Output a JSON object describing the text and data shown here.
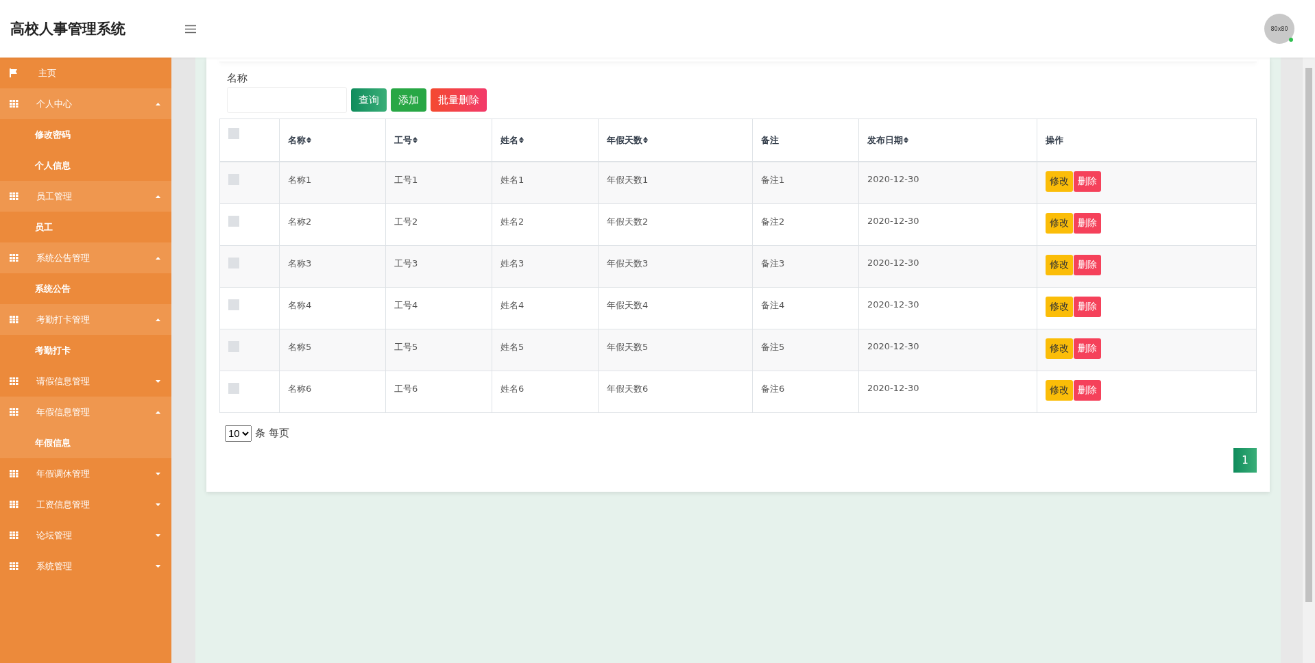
{
  "header": {
    "title": "高校人事管理系统",
    "avatar": {
      "text": "80x80",
      "online": true
    }
  },
  "sidebar": {
    "items": [
      {
        "kind": "home",
        "label": "主页",
        "selected": false
      },
      {
        "kind": "group",
        "label": "个人中心",
        "expanded": true,
        "children": [
          {
            "label": "修改密码",
            "selected": false
          },
          {
            "label": "个人信息",
            "selected": false
          }
        ]
      },
      {
        "kind": "group",
        "label": "员工管理",
        "expanded": true,
        "children": [
          {
            "label": "员工",
            "selected": false
          }
        ]
      },
      {
        "kind": "group",
        "label": "系统公告管理",
        "expanded": true,
        "children": [
          {
            "label": "系统公告",
            "selected": false
          }
        ]
      },
      {
        "kind": "group",
        "label": "考勤打卡管理",
        "expanded": true,
        "children": [
          {
            "label": "考勤打卡",
            "selected": false
          }
        ]
      },
      {
        "kind": "group",
        "label": "请假信息管理",
        "expanded": false
      },
      {
        "kind": "group",
        "label": "年假信息管理",
        "expanded": true,
        "children": [
          {
            "label": "年假信息",
            "selected": true
          }
        ]
      },
      {
        "kind": "group",
        "label": "年假调休管理",
        "expanded": false
      },
      {
        "kind": "group",
        "label": "工资信息管理",
        "expanded": false
      },
      {
        "kind": "group",
        "label": "论坛管理",
        "expanded": false
      },
      {
        "kind": "group",
        "label": "系统管理",
        "expanded": false
      }
    ]
  },
  "search": {
    "label": "名称",
    "buttons": [
      {
        "kind": "search",
        "label": "查询"
      },
      {
        "kind": "add",
        "label": "添加"
      },
      {
        "kind": "delete",
        "label": "批量删除"
      }
    ]
  },
  "table": {
    "select_all": {
      "checked": false
    },
    "columns": [
      {
        "label": "名称",
        "sortable": true
      },
      {
        "label": "工号",
        "sortable": true
      },
      {
        "label": "姓名",
        "sortable": true
      },
      {
        "label": "年假天数",
        "sortable": true
      },
      {
        "label": "备注",
        "sortable": false
      },
      {
        "label": "发布日期",
        "sortable": true
      },
      {
        "label": "操作",
        "sortable": false
      }
    ],
    "rows": [
      {
        "checked": false,
        "cells": [
          "名称1",
          "工号1",
          "姓名1",
          "年假天数1",
          "备注1",
          "2020-12-30"
        ],
        "actions": [
          "修改",
          "删除"
        ]
      },
      {
        "checked": false,
        "cells": [
          "名称2",
          "工号2",
          "姓名2",
          "年假天数2",
          "备注2",
          "2020-12-30"
        ],
        "actions": [
          "修改",
          "删除"
        ]
      },
      {
        "checked": false,
        "cells": [
          "名称3",
          "工号3",
          "姓名3",
          "年假天数3",
          "备注3",
          "2020-12-30"
        ],
        "actions": [
          "修改",
          "删除"
        ]
      },
      {
        "checked": false,
        "cells": [
          "名称4",
          "工号4",
          "姓名4",
          "年假天数4",
          "备注4",
          "2020-12-30"
        ],
        "actions": [
          "修改",
          "删除"
        ]
      },
      {
        "checked": false,
        "cells": [
          "名称5",
          "工号5",
          "姓名5",
          "年假天数5",
          "备注5",
          "2020-12-30"
        ],
        "actions": [
          "修改",
          "删除"
        ]
      },
      {
        "checked": false,
        "cells": [
          "名称6",
          "工号6",
          "姓名6",
          "年假天数6",
          "备注6",
          "2020-12-30"
        ],
        "actions": [
          "修改",
          "删除"
        ]
      }
    ]
  },
  "pagination": {
    "page_size": "10",
    "page_size_suffix": "条 每页",
    "pages": [
      {
        "label": "1",
        "selected": true
      }
    ]
  }
}
